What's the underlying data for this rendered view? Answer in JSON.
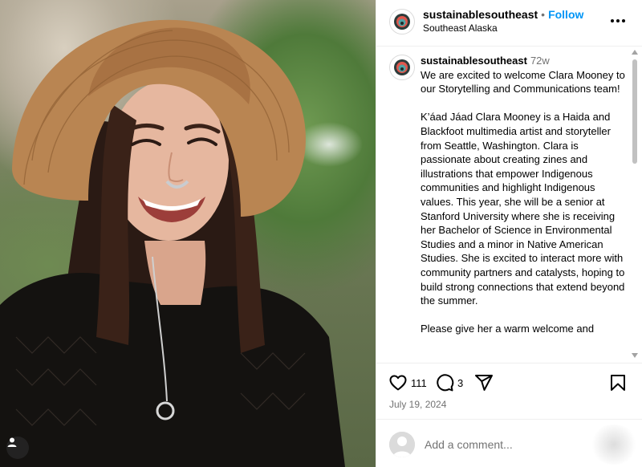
{
  "post": {
    "username": "sustainablesoutheast",
    "follow_label": "Follow",
    "location": "Southeast Alaska",
    "more_icon": "more-horizontal-icon"
  },
  "caption": {
    "username": "sustainablesoutheast",
    "age": "72w",
    "paragraphs": [
      "We are excited to welcome Clara Mooney to our Storytelling and Communications team!",
      "K’áad Jáad Clara Mooney is a Haida and Blackfoot multimedia artist and storyteller from Seattle, Washington. Clara is passionate about creating zines and illustrations that empower Indigenous communities and highlight Indigenous values. This year, she will be a senior at Stanford University where she is receiving her Bachelor of Science in Environmental Studies and a minor in Native American Studies. She is excited to interact more with community partners and catalysts, hoping to build strong connections that extend beyond the summer.",
      "Please give her a warm welcome and"
    ]
  },
  "actions": {
    "likes": "111",
    "comments": "3",
    "icons": [
      "heart-icon",
      "comment-icon",
      "share-icon",
      "bookmark-icon"
    ]
  },
  "date": "July 19, 2024",
  "comment_box": {
    "placeholder": "Add a comment..."
  },
  "colors": {
    "accent": "#0095f6",
    "muted": "#737373",
    "border": "#efefef"
  }
}
